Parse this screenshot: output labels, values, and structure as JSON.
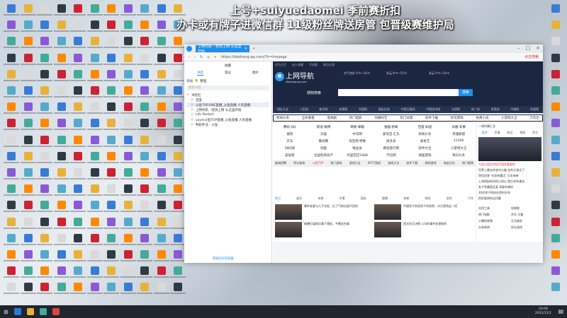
{
  "overlay": {
    "line1": "上号+suiyuedaomei 季前赛折扣",
    "line2": "办卡或有牌子进微信群 11级粉丝牌送房管 包晋级赛维护局"
  },
  "browser": {
    "tab_title": "上网导航 - 轻快上网 从这里开始",
    "url": "https://daohang.qq.com/?fr=hmpage",
    "search_hint": "点击搜索",
    "sidebar": {
      "title": "收藏",
      "tabs": [
        "书签",
        "笔记",
        "图片"
      ],
      "add": "添加",
      "organize": "整理",
      "search_placeholder": "搜索书签",
      "folder": "书签栏",
      "items": [
        "百度",
        "斗鱼TOP.ONE直播_斗鱼直播 人有直播",
        "上网导航 - 轻快上网 从这里开始",
        "Life Restart",
        "yyym斗鱼TOP直播_斗鱼直播 人有直播",
        "鸭软件法 - 斗鱼"
      ],
      "footer": "登录QQ浏览器"
    }
  },
  "page": {
    "top_links": [
      "设为主页",
      "加入收藏",
      "手机版",
      "意见反馈"
    ],
    "logo": "上网导航",
    "logo_sub": "daohang.qq.com",
    "weather": [
      "空气良好 9℃~16℃",
      "多云 8℃~15℃",
      "多云 9℃~16℃"
    ],
    "search_engine": "搜狗搜索",
    "search_button": "搜索",
    "nav": [
      "网址大全",
      "人民网",
      "新华网",
      "央视网",
      "中国网",
      "国际在线",
      "中国日报网",
      "中国经济网",
      "光明网",
      "央广网",
      "求是网",
      "中青网",
      "环球网"
    ],
    "quick": [
      "新闻头条",
      "全民看看",
      "电视剧",
      "热门电影",
      "热播综艺",
      "热门动漫",
      "软件下载",
      "好玩游戏",
      "免费小说",
      "小游戏大全",
      "万年历"
    ],
    "sites": [
      "腾讯·QQ",
      "新浪·微博",
      "网易·邮箱",
      "搜狐·新闻",
      "百度·知道",
      "凤凰·军事",
      "搜狗",
      "天猫",
      "中华网",
      "爱淘宝·汇乐",
      "新闻头条",
      "英雄联盟",
      "京东",
      "聚划算",
      "淘宝网·特惠",
      "拼多多",
      "爱奇艺",
      "12306",
      "58同城",
      "优酷",
      "唯品会",
      "携程旅行网",
      "软件大全",
      "小游戏大全",
      "安居客",
      "全国各地房产",
      "阿里巴巴1688",
      "学信网",
      "搜狐游戏",
      "每日头条"
    ],
    "hot": [
      "查询招聘",
      "积分查询",
      "斗鱼TOP",
      "热门游戏",
      "游戏大全",
      "9377游戏",
      "游戏大全",
      "软件下载",
      "我的游戏",
      "淘宝红包",
      "热门视频"
    ],
    "news_tabs": [
      "焦点",
      "娱乐",
      "体育",
      "军事",
      "国际",
      "健康",
      "体育",
      "财经",
      "女性",
      "汽车"
    ],
    "news": [
      "事件老婆与儿子决定，后了气势出面不愿担",
      "中国男子发现男子的秘密，对方竟然这一招",
      "被曝打架前后事下落低，今晚这些事",
      "西大妈王决裂 公司的事件处理和的"
    ],
    "right_title": "一线时事汇总",
    "right_tabs": [
      "推荐",
      "军事",
      "热点",
      "视频",
      "养生"
    ],
    "right_news": [
      "今起日国民将经手国家重要性",
      "世界上最长的农村公路 在的方说出了",
      "拜坦回答 '任务有重点' 日本有新",
      "上海两街的风险已经以 就方发布通告",
      "女子到美国买某 驾驶车辆时",
      "30岁男子的妈在家时开车",
      "药房竟然的出问题"
    ],
    "tools": [
      "实用工具",
      "电视剧",
      "热门电影",
      "京东 天猫",
      "火爆短视频",
      "生活服务",
      "头条新闻",
      "好玩游戏"
    ]
  },
  "taskbar": {
    "time": "20:09",
    "date": "2021/12/1"
  }
}
